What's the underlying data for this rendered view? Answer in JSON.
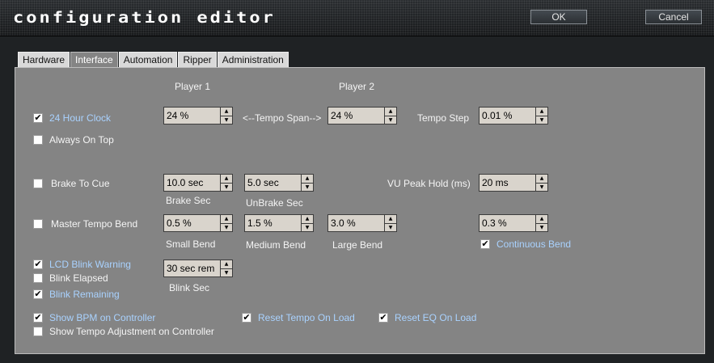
{
  "window": {
    "title": "configuration editor",
    "ok_label": "OK",
    "cancel_label": "Cancel"
  },
  "tabs": [
    {
      "label": "Hardware",
      "active": false
    },
    {
      "label": "Interface",
      "active": true
    },
    {
      "label": "Automation",
      "active": false
    },
    {
      "label": "Ripper",
      "active": false
    },
    {
      "label": "Administration",
      "active": false
    }
  ],
  "headers": {
    "player1": "Player 1",
    "player2": "Player 2"
  },
  "clock": {
    "label": "24 Hour Clock",
    "checked": true,
    "player1_value": "24 %",
    "tempo_span_label": "<--Tempo Span-->",
    "player2_value": "24 %",
    "tempo_step_label": "Tempo Step",
    "tempo_step_value": "0.01 %"
  },
  "always_on_top": {
    "label": "Always On Top",
    "checked": false
  },
  "brake": {
    "label": "Brake To Cue",
    "checked": false,
    "brake_sec_value": "10.0 sec",
    "brake_sec_label": "Brake Sec",
    "unbrake_sec_value": "5.0 sec",
    "unbrake_sec_label": "UnBrake Sec",
    "vu_label": "VU Peak Hold (ms)",
    "vu_value": "20 ms"
  },
  "bend": {
    "label": "Master Tempo Bend",
    "checked": false,
    "small_value": "0.5 %",
    "small_label": "Small Bend",
    "medium_value": "1.5 %",
    "medium_label": "Medium Bend",
    "large_value": "3.0 %",
    "large_label": "Large Bend",
    "continuous_value": "0.3 %",
    "continuous_label": "Continuous Bend",
    "continuous_checked": true
  },
  "blink": {
    "lcd_label": "LCD Blink Warning",
    "lcd_checked": true,
    "elapsed_label": "Blink Elapsed",
    "elapsed_checked": false,
    "remaining_label": "Blink Remaining",
    "remaining_checked": true,
    "sec_value": "30 sec rem",
    "sec_label": "Blink Sec"
  },
  "controller": {
    "show_bpm_label": "Show BPM on Controller",
    "show_bpm_checked": true,
    "show_tempo_label": "Show Tempo Adjustment on Controller",
    "show_tempo_checked": false,
    "reset_tempo_label": "Reset Tempo On Load",
    "reset_tempo_checked": true,
    "reset_eq_label": "Reset EQ On Load",
    "reset_eq_checked": true
  },
  "colors": {
    "panel": "#848484",
    "active_label": "#a9d2ff",
    "field": "#d9d4cc"
  },
  "icons": {
    "check": "✔",
    "spin_up": "▲",
    "spin_down": "▼"
  }
}
